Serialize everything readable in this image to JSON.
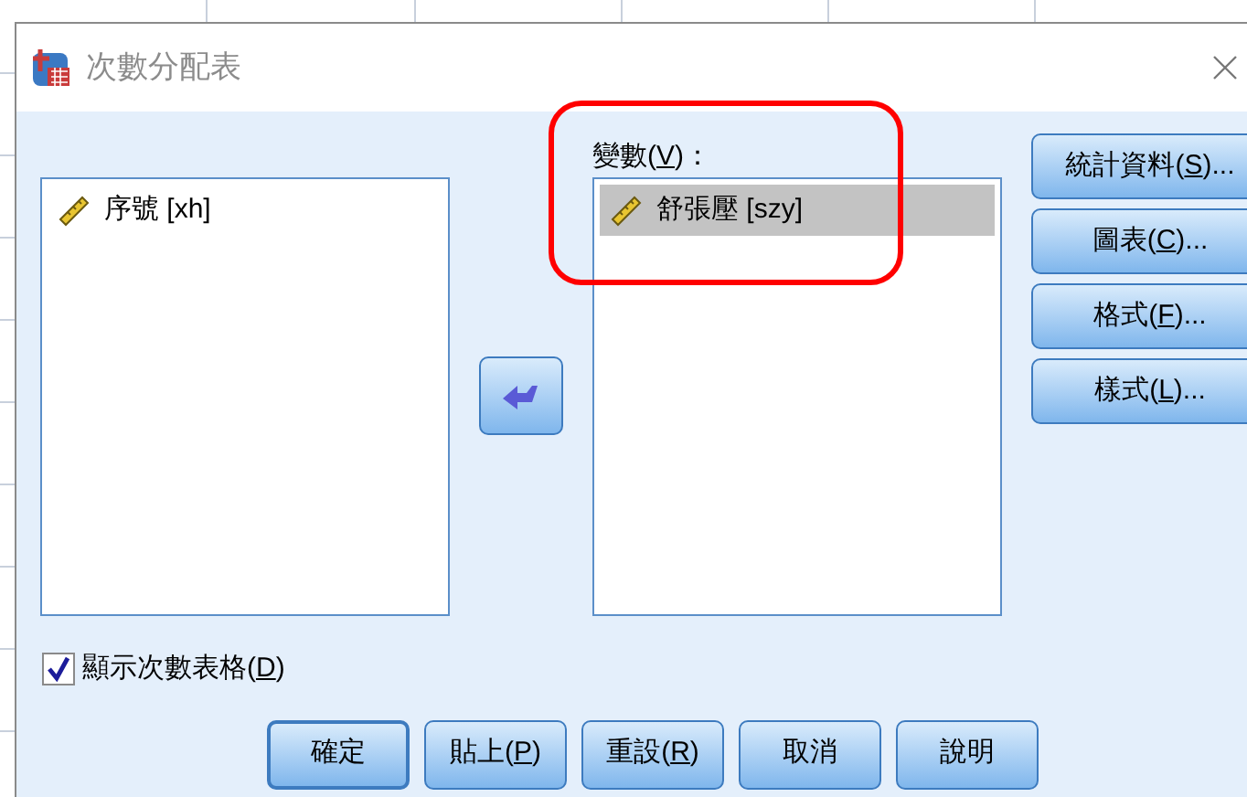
{
  "window": {
    "title": "次數分配表"
  },
  "source_list": {
    "items": [
      {
        "label": "序號 [xh]",
        "selected": false
      }
    ]
  },
  "variables": {
    "label": "變數(V)：",
    "items": [
      {
        "label": "舒張壓 [szy]",
        "selected": true
      }
    ]
  },
  "side_buttons": [
    {
      "label": "統計資料(S)..."
    },
    {
      "label": "圖表(C)..."
    },
    {
      "label": "格式(F)..."
    },
    {
      "label": "樣式(L)..."
    }
  ],
  "display_table": {
    "label": "顯示次數表格(D)",
    "checked": true
  },
  "buttons": [
    {
      "label": "確定",
      "default": true
    },
    {
      "label": "貼上(P)",
      "default": false
    },
    {
      "label": "重設(R)",
      "default": false
    },
    {
      "label": "取消",
      "default": false
    },
    {
      "label": "說明",
      "default": false
    }
  ]
}
